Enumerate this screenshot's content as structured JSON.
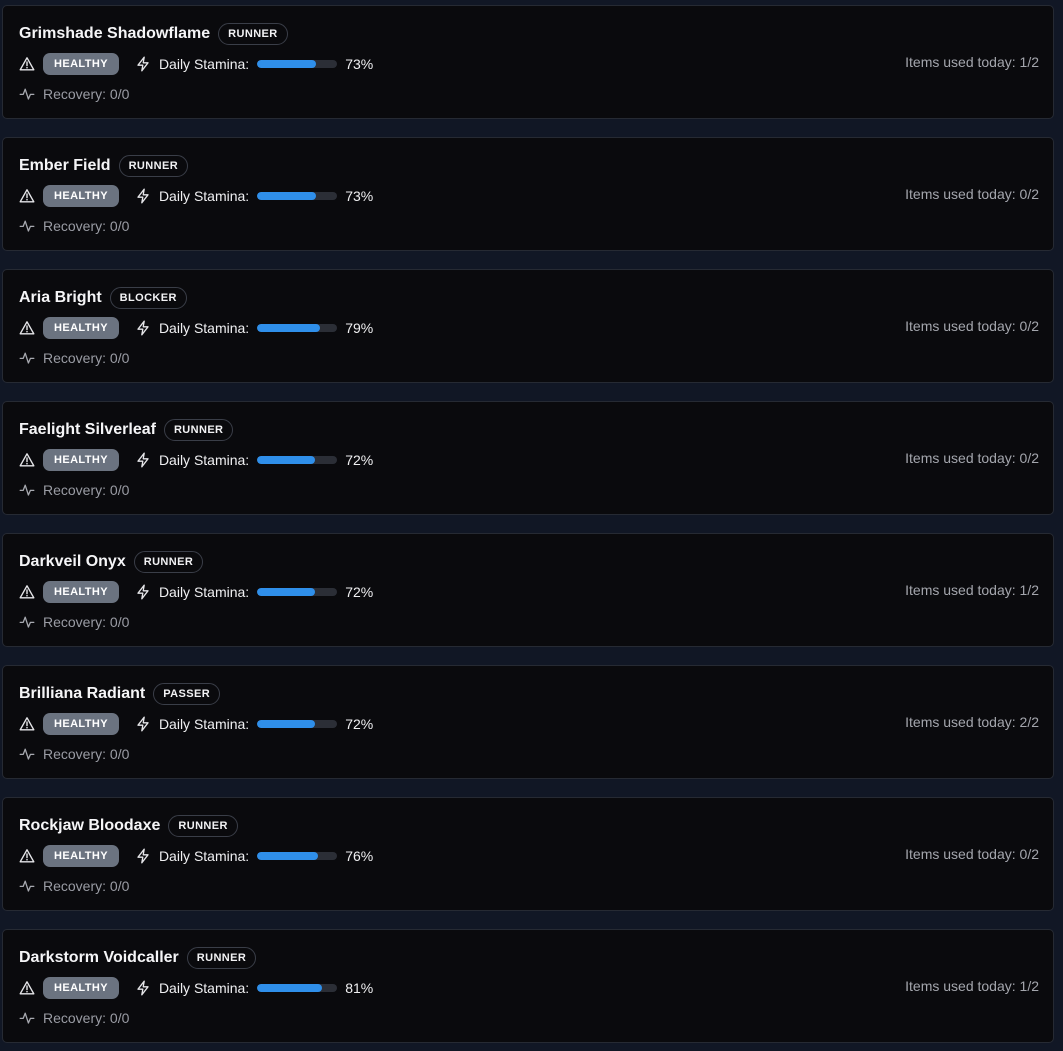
{
  "labels": {
    "stamina": "Daily Stamina:",
    "recovery": "Recovery: 0/0"
  },
  "colors": {
    "card_bg": "#0a0a0d",
    "page_bg": "#111725",
    "health_badge": "#6b7380",
    "stamina_fill": "#2f8fea"
  },
  "players": [
    {
      "name": "Grimshade Shadowflame",
      "role": "RUNNER",
      "status": "HEALTHY",
      "stamina_pct": 73,
      "stamina_text": "73%",
      "items_used": "Items used today: 1/2"
    },
    {
      "name": "Ember Field",
      "role": "RUNNER",
      "status": "HEALTHY",
      "stamina_pct": 73,
      "stamina_text": "73%",
      "items_used": "Items used today: 0/2"
    },
    {
      "name": "Aria Bright",
      "role": "BLOCKER",
      "status": "HEALTHY",
      "stamina_pct": 79,
      "stamina_text": "79%",
      "items_used": "Items used today: 0/2"
    },
    {
      "name": "Faelight Silverleaf",
      "role": "RUNNER",
      "status": "HEALTHY",
      "stamina_pct": 72,
      "stamina_text": "72%",
      "items_used": "Items used today: 0/2"
    },
    {
      "name": "Darkveil Onyx",
      "role": "RUNNER",
      "status": "HEALTHY",
      "stamina_pct": 72,
      "stamina_text": "72%",
      "items_used": "Items used today: 1/2"
    },
    {
      "name": "Brilliana Radiant",
      "role": "PASSER",
      "status": "HEALTHY",
      "stamina_pct": 72,
      "stamina_text": "72%",
      "items_used": "Items used today: 2/2"
    },
    {
      "name": "Rockjaw Bloodaxe",
      "role": "RUNNER",
      "status": "HEALTHY",
      "stamina_pct": 76,
      "stamina_text": "76%",
      "items_used": "Items used today: 0/2"
    },
    {
      "name": "Darkstorm Voidcaller",
      "role": "RUNNER",
      "status": "HEALTHY",
      "stamina_pct": 81,
      "stamina_text": "81%",
      "items_used": "Items used today: 1/2"
    }
  ]
}
